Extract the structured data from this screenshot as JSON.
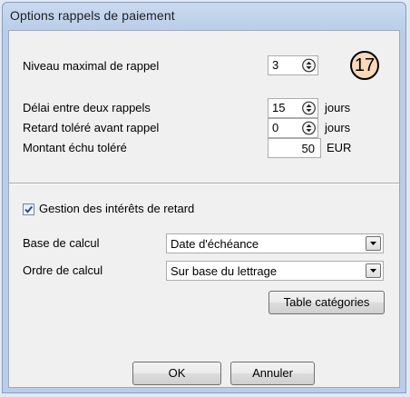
{
  "window": {
    "title": "Options rappels de paiement"
  },
  "badge": {
    "number": "17"
  },
  "fields": {
    "niveau_max": {
      "label": "Niveau maximal de rappel",
      "value": "3"
    },
    "delai": {
      "label": "Délai entre deux rappels",
      "value": "15",
      "unit": "jours"
    },
    "retard": {
      "label": "Retard toléré avant rappel",
      "value": "0",
      "unit": "jours"
    },
    "montant": {
      "label": "Montant échu toléré",
      "value": "50",
      "unit": "EUR"
    }
  },
  "interets": {
    "checkbox_label": "Gestion des intérêts de retard",
    "checked": true,
    "base": {
      "label": "Base de calcul",
      "value": "Date d'échéance"
    },
    "ordre": {
      "label": "Ordre de calcul",
      "value": "Sur base du lettrage"
    },
    "table_button": "Table catégories"
  },
  "buttons": {
    "ok": "OK",
    "cancel": "Annuler"
  },
  "icons": {
    "spin": "up-down-spinner-icon",
    "dropdown": "chevron-down-icon",
    "check": "checkmark-icon"
  },
  "colors": {
    "badge_fill": "#f9d9b8",
    "check": "#2b4a8b"
  }
}
